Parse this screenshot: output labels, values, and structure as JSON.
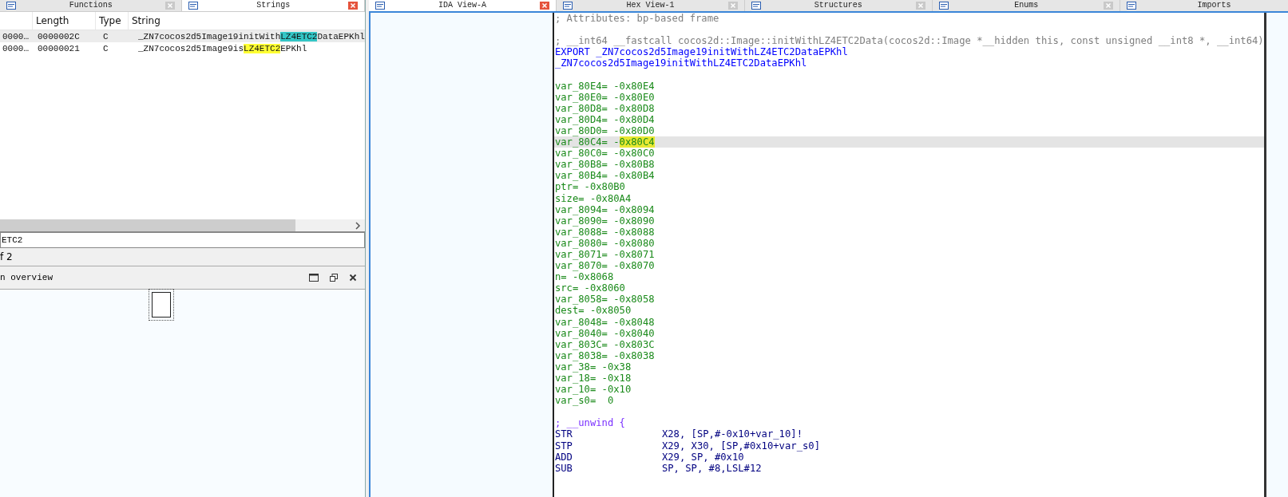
{
  "left_panel": {
    "tabs": [
      {
        "label": "Functions",
        "selected": false
      },
      {
        "label": "Strings",
        "selected": true
      }
    ],
    "strings_table": {
      "columns": [
        "Length",
        "Type",
        "String"
      ],
      "rows": [
        {
          "address": "0000…",
          "length": "0000002C",
          "type": "C",
          "prefix": "_ZN7cocos2d5Image19initWith",
          "match": "LZ4ETC2",
          "suffix": "DataEPKhl",
          "selected": true
        },
        {
          "address": "0000…",
          "length": "00000021",
          "type": "C",
          "prefix": "_ZN7cocos2d5Image9is",
          "match": "LZ4ETC2",
          "suffix": "EPKhl",
          "selected": false
        }
      ]
    },
    "search": {
      "value": "ETC2"
    },
    "status": "f 2",
    "overview": {
      "title": "n overview"
    }
  },
  "main_tabs": [
    {
      "label": "IDA View-A",
      "selected": true
    },
    {
      "label": "Hex View-1",
      "selected": false
    },
    {
      "label": "Structures",
      "selected": false
    },
    {
      "label": "Enums",
      "selected": false
    },
    {
      "label": "Imports",
      "selected": false
    }
  ],
  "code_lines": [
    {
      "kind": "comment",
      "text": "; Attributes: bp-based frame"
    },
    {
      "kind": "blank"
    },
    {
      "kind": "comment",
      "text": "; __int64 __fastcall cocos2d::Image::initWithLZ4ETC2Data(cocos2d::Image *__hidden this, const unsigned __int8 *, __int64)"
    },
    {
      "kind": "symbol",
      "text": "EXPORT _ZN7cocos2d5Image19initWithLZ4ETC2DataEPKhl"
    },
    {
      "kind": "symbol",
      "text": "_ZN7cocos2d5Image19initWithLZ4ETC2DataEPKhl"
    },
    {
      "kind": "blank"
    },
    {
      "kind": "var",
      "text": "var_80E4= -0x80E4",
      "selected": false
    },
    {
      "kind": "var",
      "text": "var_80E0= -0x80E0",
      "selected": false
    },
    {
      "kind": "var",
      "text": "var_80D8= -0x80D8",
      "selected": false
    },
    {
      "kind": "var",
      "text": "var_80D4= -0x80D4",
      "selected": false
    },
    {
      "kind": "var",
      "text": "var_80D0= -0x80D0",
      "selected": false
    },
    {
      "kind": "var",
      "text": "var_80C4= -",
      "highlight": "0x80C4",
      "selected": true
    },
    {
      "kind": "var",
      "text": "var_80C0= -0x80C0",
      "selected": false
    },
    {
      "kind": "var",
      "text": "var_80B8= -0x80B8",
      "selected": false
    },
    {
      "kind": "var",
      "text": "var_80B4= -0x80B4",
      "selected": false
    },
    {
      "kind": "var",
      "text": "ptr= -0x80B0",
      "selected": false
    },
    {
      "kind": "var",
      "text": "size= -0x80A4",
      "selected": false
    },
    {
      "kind": "var",
      "text": "var_8094= -0x8094",
      "selected": false
    },
    {
      "kind": "var",
      "text": "var_8090= -0x8090",
      "selected": false
    },
    {
      "kind": "var",
      "text": "var_8088= -0x8088",
      "selected": false
    },
    {
      "kind": "var",
      "text": "var_8080= -0x8080",
      "selected": false
    },
    {
      "kind": "var",
      "text": "var_8071= -0x8071",
      "selected": false
    },
    {
      "kind": "var",
      "text": "var_8070= -0x8070",
      "selected": false
    },
    {
      "kind": "var",
      "text": "n= -0x8068",
      "selected": false
    },
    {
      "kind": "var",
      "text": "src= -0x8060",
      "selected": false
    },
    {
      "kind": "var",
      "text": "var_8058= -0x8058",
      "selected": false
    },
    {
      "kind": "var",
      "text": "dest= -0x8050",
      "selected": false
    },
    {
      "kind": "var",
      "text": "var_8048= -0x8048",
      "selected": false
    },
    {
      "kind": "var",
      "text": "var_8040= -0x8040",
      "selected": false
    },
    {
      "kind": "var",
      "text": "var_803C= -0x803C",
      "selected": false
    },
    {
      "kind": "var",
      "text": "var_8038= -0x8038",
      "selected": false
    },
    {
      "kind": "var",
      "text": "var_38= -0x38",
      "selected": false
    },
    {
      "kind": "var",
      "text": "var_18= -0x18",
      "selected": false
    },
    {
      "kind": "var",
      "text": "var_10= -0x10",
      "selected": false
    },
    {
      "kind": "var",
      "text": "var_s0=  0",
      "selected": false
    },
    {
      "kind": "blank"
    },
    {
      "kind": "directive",
      "text": "; __unwind {"
    },
    {
      "kind": "instr",
      "mnemonic": "STR",
      "operands": "X28, [SP,#-0x10+var_10]!"
    },
    {
      "kind": "instr",
      "mnemonic": "STP",
      "operands": "X29, X30, [SP,#0x10+var_s0]"
    },
    {
      "kind": "instr",
      "mnemonic": "ADD",
      "operands": "X29, SP, #0x10"
    },
    {
      "kind": "instr",
      "mnemonic": "SUB",
      "operands": "SP, SP, #8,LSL#12"
    }
  ]
}
